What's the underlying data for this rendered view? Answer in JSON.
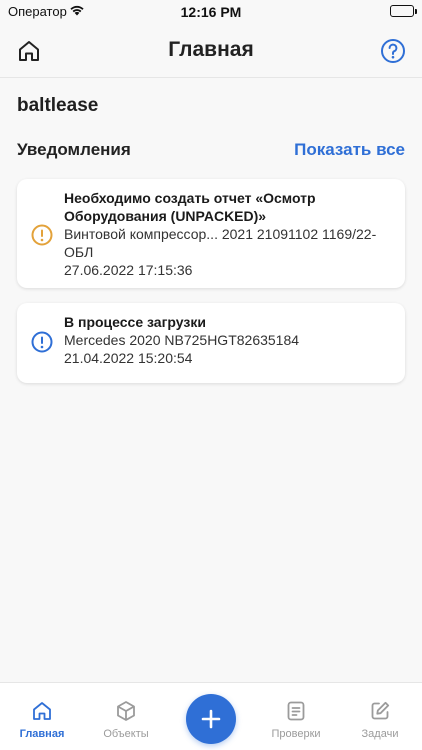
{
  "status_bar": {
    "carrier": "Оператор",
    "time": "12:16 PM"
  },
  "header": {
    "title": "Главная",
    "home_icon": "home-icon",
    "help_icon": "help-icon"
  },
  "org_name": "baltlease",
  "notifications": {
    "section_title": "Уведомления",
    "show_all_label": "Показать все",
    "items": [
      {
        "title_line1": "Необходимо создать отчет «Осмотр",
        "title_line2": "Оборудования (UNPACKED)»",
        "desc_line1": "Винтовой компрессор... 2021 21091102 1169/22-",
        "desc_line2": "ОБЛ",
        "date": "27.06.2022 17:15:36",
        "icon": "warning-circle-icon",
        "icon_color": "#e3a23a"
      },
      {
        "title_line1": "В процессе загрузки",
        "desc_line1": "Mercedes 2020 NB725HGT82635184",
        "date": "21.04.2022 15:20:54",
        "icon": "info-circle-icon",
        "icon_color": "#2f6fd6"
      }
    ]
  },
  "tab_bar": {
    "home": "Главная",
    "objects": "Объекты",
    "checks": "Проверки",
    "tasks": "Задачи",
    "add_icon": "plus-icon"
  },
  "colors": {
    "accent": "#2f6fd6",
    "warning": "#e3a23a",
    "inactive": "#9b9b9b"
  }
}
